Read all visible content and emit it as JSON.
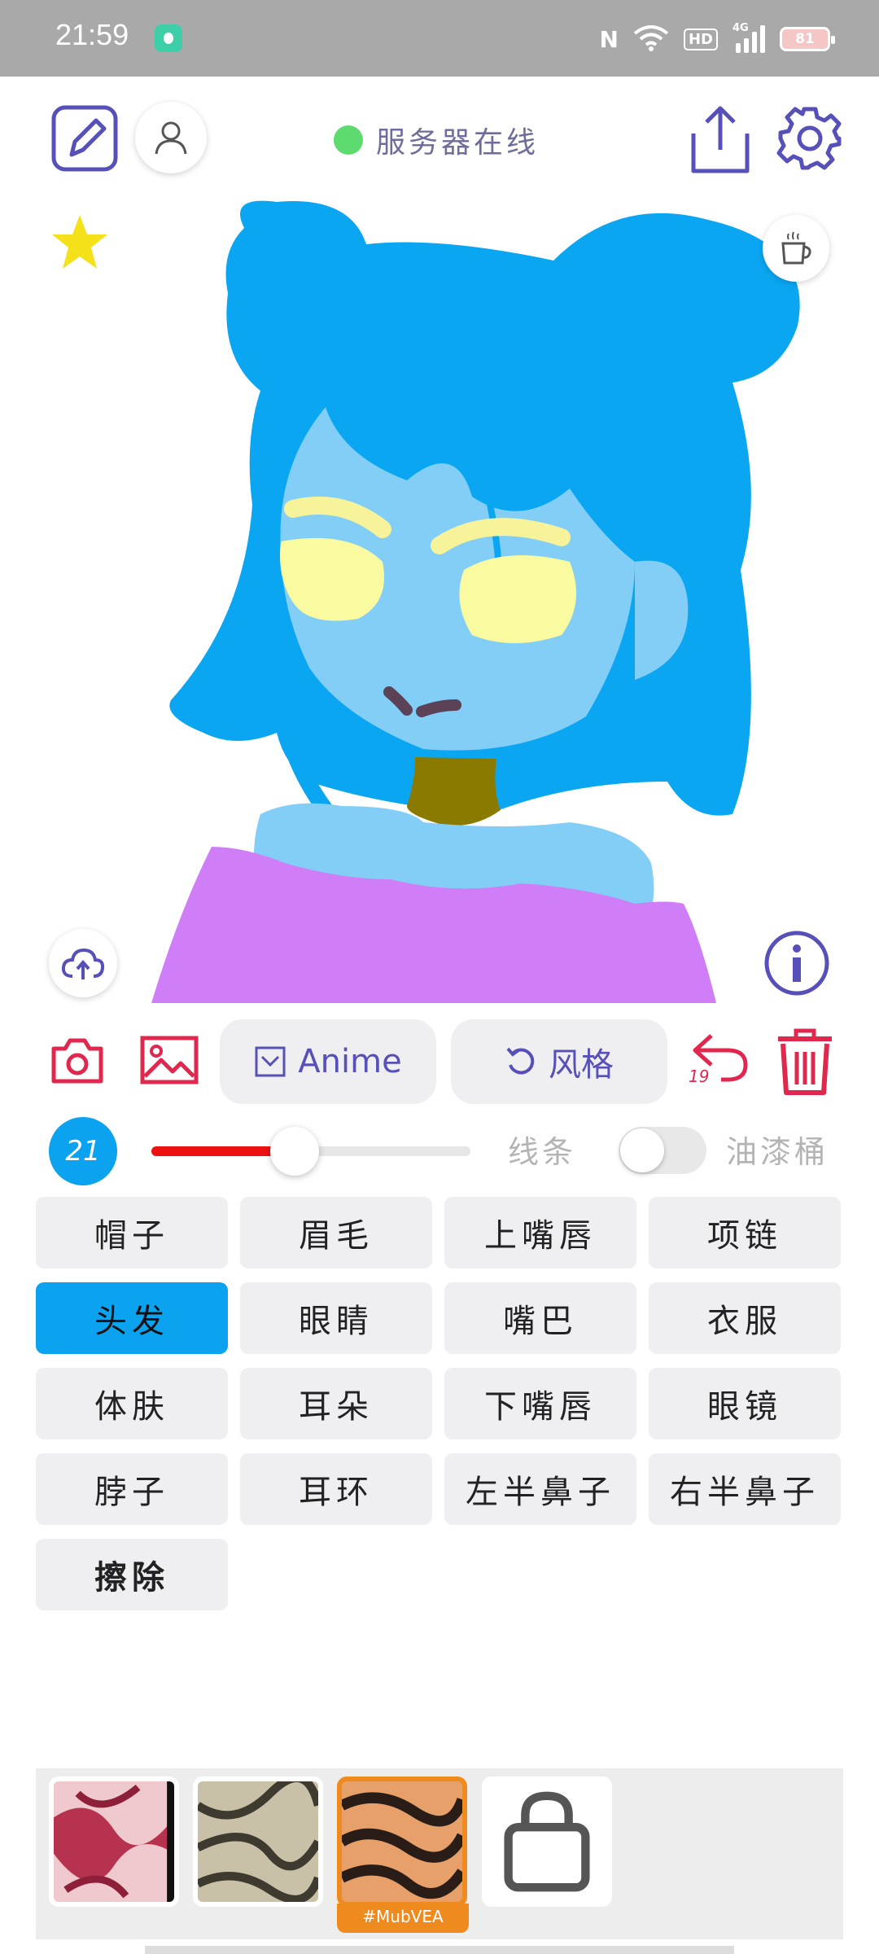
{
  "status_bar": {
    "time": "21:59",
    "network": "4G",
    "hd": "HD",
    "nfc": "N",
    "battery": "81"
  },
  "header": {
    "server_status": "服务器在线",
    "server_status_color": "#5ddb6e"
  },
  "canvas": {
    "icons": [
      "star-icon",
      "coffee-cup-icon",
      "cloud-upload-icon",
      "info-icon"
    ]
  },
  "toolbar": {
    "anime_label": "Anime",
    "style_label": "风格",
    "undo_count": "19"
  },
  "brush": {
    "size": "21",
    "size_level": 0.45,
    "line_label": "线条",
    "bucket_label": "油漆桶",
    "bucket_enabled": false,
    "color": "#ee1111"
  },
  "parts": [
    {
      "label": "帽子",
      "active": false
    },
    {
      "label": "眉毛",
      "active": false
    },
    {
      "label": "上嘴唇",
      "active": false
    },
    {
      "label": "项链",
      "active": false
    },
    {
      "label": "头发",
      "active": true
    },
    {
      "label": "眼睛",
      "active": false
    },
    {
      "label": "嘴巴",
      "active": false
    },
    {
      "label": "衣服",
      "active": false
    },
    {
      "label": "体肤",
      "active": false
    },
    {
      "label": "耳朵",
      "active": false
    },
    {
      "label": "下嘴唇",
      "active": false
    },
    {
      "label": "眼镜",
      "active": false
    },
    {
      "label": "脖子",
      "active": false
    },
    {
      "label": "耳环",
      "active": false
    },
    {
      "label": "左半鼻子",
      "active": false
    },
    {
      "label": "右半鼻子",
      "active": false
    },
    {
      "label": "擦除",
      "active": false
    }
  ],
  "styles": {
    "selected_tag": "#MubVEA"
  },
  "colors": {
    "accent": "#5650b8",
    "danger": "#e0284f",
    "active_part": "#0ba2ef"
  }
}
